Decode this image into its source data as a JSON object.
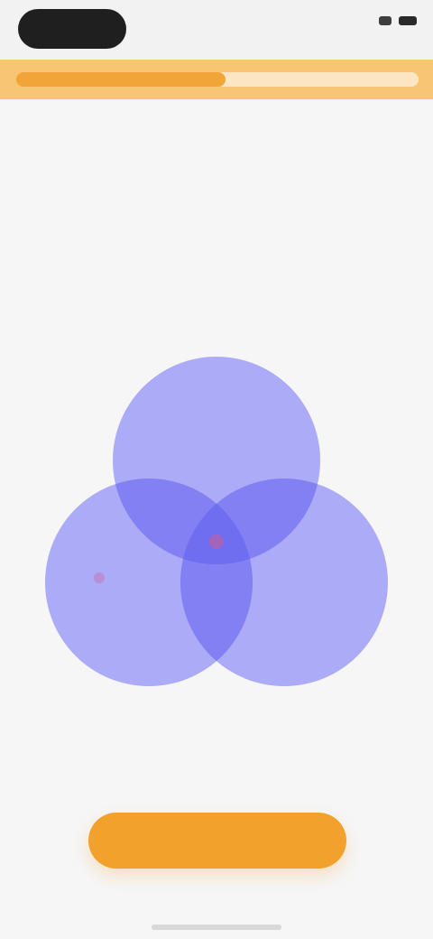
{
  "app": {
    "back_label": "",
    "status_time": ""
  },
  "progress": {
    "value": 0.52
  },
  "header": {
    "title": "",
    "subtitle": ""
  },
  "diagram": {
    "labels": {
      "top": "",
      "left": "",
      "right": "",
      "center": ""
    },
    "colors": {
      "circle": "#a7a6f7",
      "overlap": "#7b79f2",
      "center_dot": "#d05b8f"
    }
  },
  "actions": {
    "primary_label": ""
  },
  "colors": {
    "accent": "#f2a12d",
    "background": "#f6f6f6"
  }
}
